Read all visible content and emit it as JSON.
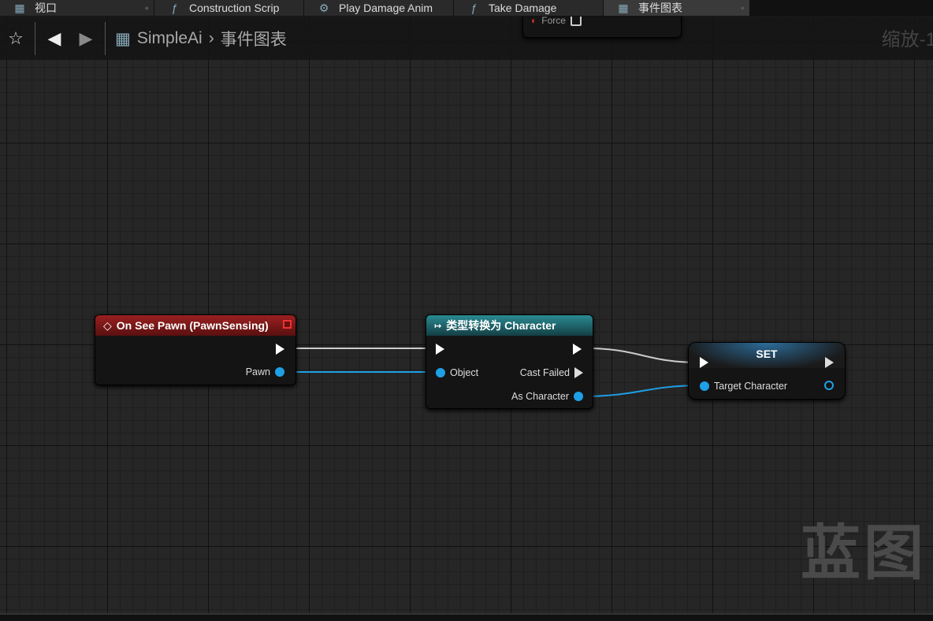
{
  "tabs": [
    {
      "label": "视口",
      "icon": "viewport-icon"
    },
    {
      "label": "Construction Scrip",
      "icon": "function-icon"
    },
    {
      "label": "Play Damage Anim",
      "icon": "gear-icon"
    },
    {
      "label": "Take Damage",
      "icon": "function-icon"
    },
    {
      "label": "事件图表",
      "icon": "graph-icon",
      "active": true
    }
  ],
  "breadcrumb": {
    "root": "SimpleAi",
    "sep": "›",
    "current": "事件图表"
  },
  "zoom_label": "缩放-1",
  "partial_node": {
    "pin": "Force"
  },
  "nodes": {
    "event": {
      "title": "On See Pawn (PawnSensing)",
      "color": "#8b1a1a",
      "pin": "Pawn"
    },
    "cast": {
      "title": "类型转换为 Character",
      "color": "#1d6f78",
      "in": "Object",
      "cast_failed": "Cast Failed",
      "out": "As Character"
    },
    "set": {
      "title": "SET",
      "pin": "Target Character"
    }
  },
  "watermark": "蓝图",
  "colors": {
    "exec_wire": "#cccccc",
    "object_wire": "#1ea0e6"
  }
}
